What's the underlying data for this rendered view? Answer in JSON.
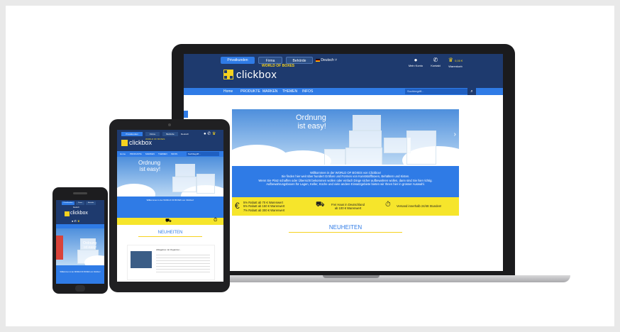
{
  "laptop": {
    "top_buttons": [
      "Privatkunden",
      "Firma",
      "Behörde"
    ],
    "language": "Deutsch",
    "language_flag": "de-flag-icon",
    "tools": [
      {
        "icon": "user-icon",
        "label": "Mein Konto"
      },
      {
        "icon": "phone-icon",
        "label": "Kontakt"
      },
      {
        "icon": "cart-icon",
        "label": "Warenkorb",
        "amount": "0,00 €"
      }
    ],
    "logo": {
      "text": "clickbox",
      "tagline": "WORLD OF BOXES",
      "mark": "®"
    },
    "nav": [
      "Home",
      "PRODUKTE",
      "MARKEN",
      "THEMEN",
      "INFOS"
    ],
    "search_placeholder": "Suchbegriff...",
    "hero": {
      "line1": "Ordnung",
      "line2": "ist easy!"
    },
    "welcome": {
      "line1": "Willkommen in der WORLD OF BOXES von Clickbox!",
      "line2": "Sie finden hier weit über hundert Größen und Formen von Kunststoffboxen, Behältern und Kisten.",
      "line3": "Wenn Sie Platz schaffen oder Übersicht bekommen wollen oder einfach Dinge sicher aufbewahren wollen, dann sind Sie hier richtig.",
      "line4": "Aufbewahrungsboxen für Lagen, Keller, Küche und viele andere Einsatzgebiete bieten wir Ihnen hier in grosser Auswahl."
    },
    "usp": {
      "discount": [
        "5% Rabatt ab  70 € Warenwert",
        "5% Rabatt ab 150 € Warenwert",
        "7% Rabatt ab 300 € Warenwert"
      ],
      "shipping": [
        "Frei Haus in Deutschland",
        "ab 100 € Warenwert"
      ],
      "delivery": "Versand innerhalb 24/48 Stunden!"
    },
    "section_title": "NEUHEITEN"
  },
  "tablet": {
    "top_buttons": [
      "Privatkunden",
      "Firma",
      "Behörde"
    ],
    "language": "Deutsch",
    "logo": "clickbox",
    "tagline": "WORLD OF BOXES",
    "nav": [
      "Home",
      "PRODUKTE",
      "MARKEN",
      "THEMEN",
      "INFOS"
    ],
    "search_placeholder": "Suchbegriff...",
    "hero": {
      "line1": "Ordnung",
      "line2": "ist easy!"
    },
    "welcome_title": "Willkommen in der WORLD OF BOXES von Clickbox!",
    "section_title": "NEUHEITEN",
    "product_title": "Ablagebox mit Organizer..."
  },
  "phone": {
    "top_buttons": [
      "Privatkunden",
      "Firma",
      "Behörde"
    ],
    "language": "Deutsch",
    "logo": "clickbox",
    "hero": {
      "line1": "Ordnung",
      "line2": "ist easy!"
    },
    "welcome": "Willkommen in der WORLD OF BOXES von Clickbox!"
  },
  "colors": {
    "navy": "#1e3a6e",
    "blue": "#2f7be6",
    "yellow": "#f6e52b",
    "logo_yellow": "#f6d21f"
  }
}
